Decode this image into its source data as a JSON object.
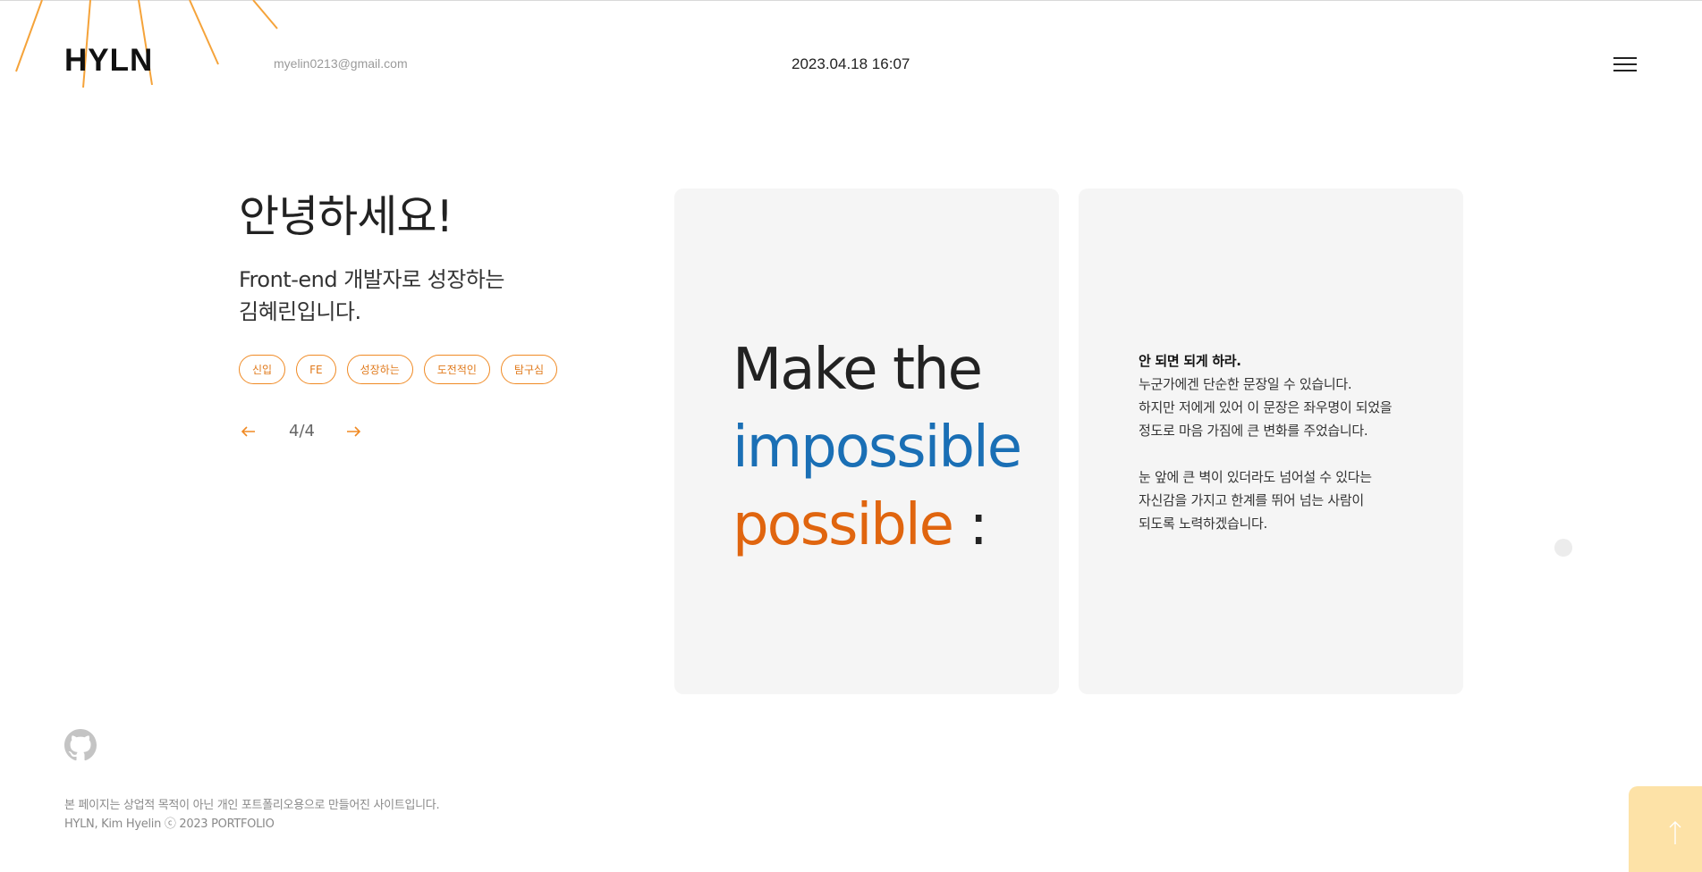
{
  "header": {
    "logo": "HYLN",
    "email": "myelin0213@gmail.com",
    "datetime": "2023.04.18 16:07",
    "menu_icon": "hamburger-icon"
  },
  "hero": {
    "greeting": "안녕하세요!",
    "intro_line1": "Front-end 개발자로 성장하는",
    "intro_line2": "김혜린입니다.",
    "tags": [
      "신입",
      "FE",
      "성장하는",
      "도전적인",
      "탐구심"
    ]
  },
  "pager": {
    "prev_icon": "arrow-left-icon",
    "next_icon": "arrow-right-icon",
    "count": "4/4"
  },
  "card_motto": {
    "line1": "Make the",
    "line2": "impossible",
    "line3": "possible",
    "line3_suffix": " :"
  },
  "card_text": {
    "heading": "안 되면 되게 하라.",
    "para1_line1": "누군가에겐 단순한 문장일 수 있습니다.",
    "para1_line2": "하지만 저에게 있어 이 문장은 좌우명이 되었을",
    "para1_line3": "정도로 마음 가짐에 큰 변화를 주었습니다.",
    "para2_line1": "눈 앞에 큰 벽이 있더라도 넘어설 수 있다는",
    "para2_line2": "자신감을 가지고 한계를 뛰어 넘는 사람이",
    "para2_line3": "되도록 노력하겠습니다."
  },
  "footer": {
    "github_icon": "github-icon",
    "note": "본 페이지는 상업적 목적이 아닌 개인 포트폴리오용으로 만들어진 사이트입니다.",
    "copyright": "HYLN, Kim Hyelin ⓒ 2023 PORTFOLIO"
  },
  "scroll_top": {
    "icon": "arrow-up-icon"
  },
  "colors": {
    "accent_orange": "#f08a24",
    "motto_blue": "#1a6fb5",
    "motto_orange": "#e0650f",
    "card_bg": "#f5f5f5",
    "top_button_bg": "#fde2a7"
  }
}
